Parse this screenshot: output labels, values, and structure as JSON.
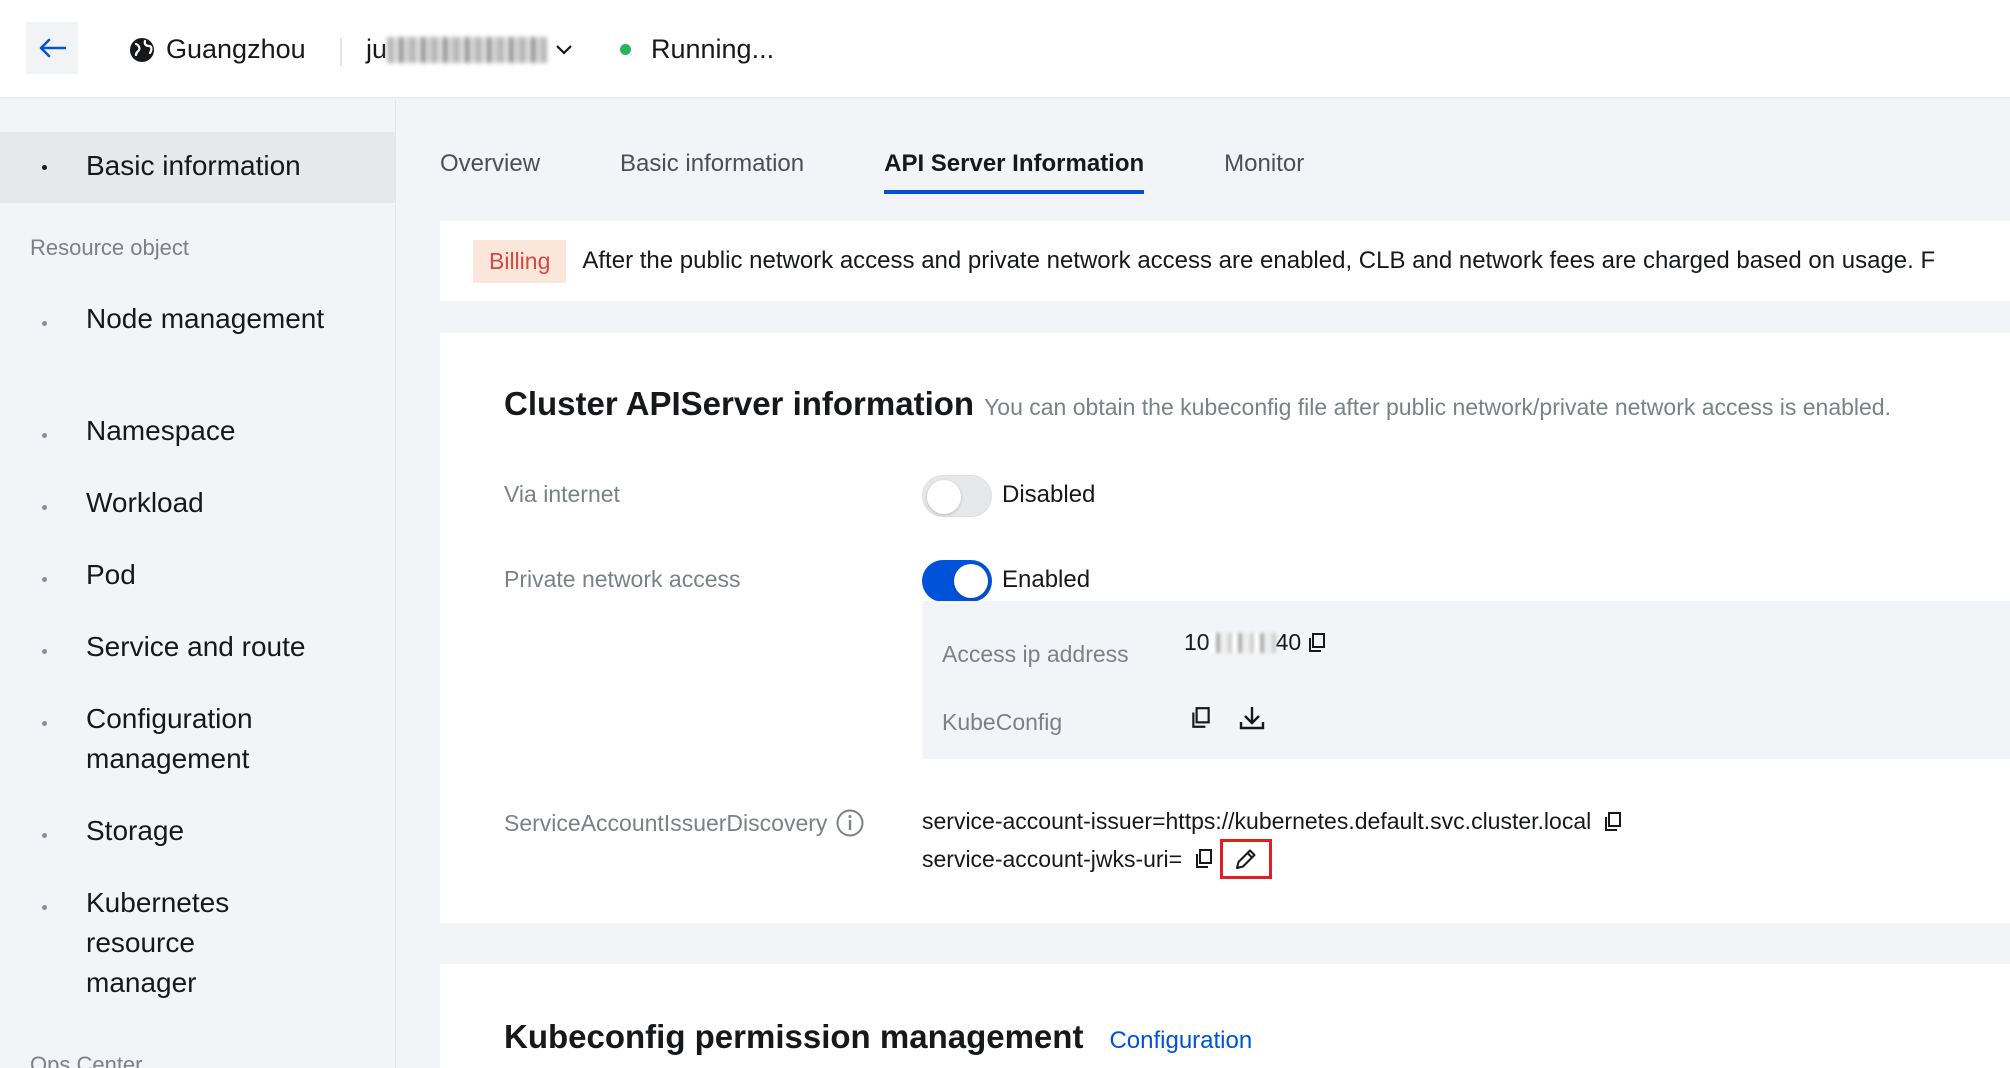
{
  "header": {
    "region": "Guangzhou",
    "cluster_name_prefix": "ju",
    "status": "Running..."
  },
  "sidebar": {
    "active_item": "Basic information",
    "section_resource": "Resource object",
    "items": [
      {
        "label": "Node management"
      },
      {
        "label": "Namespace"
      },
      {
        "label": "Workload"
      },
      {
        "label": "Pod"
      },
      {
        "label": "Service and route"
      },
      {
        "label": "Configuration management"
      },
      {
        "label": "Storage"
      },
      {
        "label": "Kubernetes resource manager"
      }
    ],
    "section_ops": "Ops Center"
  },
  "tabs": [
    {
      "label": "Overview",
      "active": false
    },
    {
      "label": "Basic information",
      "active": false
    },
    {
      "label": "API Server Information",
      "active": true
    },
    {
      "label": "Monitor",
      "active": false
    }
  ],
  "billing": {
    "tag": "Billing",
    "text": "After the public network access and private network access are enabled, CLB and network fees are charged based on usage. F"
  },
  "apiserver": {
    "title": "Cluster APIServer information",
    "description": "You can obtain the kubeconfig file after public network/private network access is enabled.",
    "via_internet_label": "Via internet",
    "via_internet_state": "Disabled",
    "private_access_label": "Private network access",
    "private_access_state": "Enabled",
    "access_ip_label": "Access ip address",
    "access_ip_prefix": "10",
    "access_ip_suffix": "40",
    "kubeconfig_label": "KubeConfig",
    "sa_label": "ServiceAccountIssuerDiscovery",
    "sa_issuer": "service-account-issuer=https://kubernetes.default.svc.cluster.local",
    "sa_jwks": "service-account-jwks-uri="
  },
  "kubeconfig_perm": {
    "title": "Kubeconfig permission management",
    "link": "Configuration"
  },
  "colors": {
    "accent": "#0052d9",
    "running": "#29b15c",
    "highlight": "#e02020"
  }
}
